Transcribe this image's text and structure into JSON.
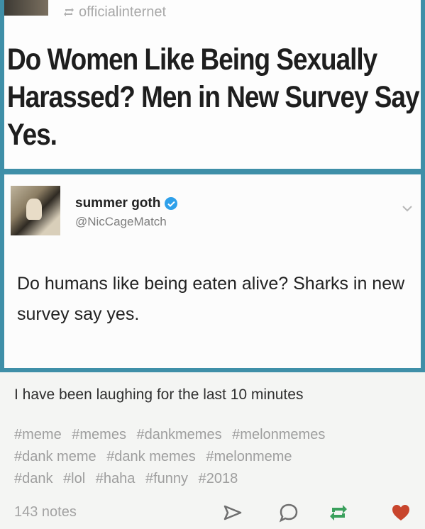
{
  "reblog": {
    "username": "officialinternet",
    "icon": "reblog-icon"
  },
  "headline": {
    "text": "Do Women Like Being Sexually Harassed? Men in New Survey Say Yes."
  },
  "tweet": {
    "display_name": "summer goth",
    "handle": "@NicCageMatch",
    "verified": true,
    "text": "Do humans like being eaten alive? Sharks in new survey say yes."
  },
  "post": {
    "caption": "I have been laughing for the last 10 minutes",
    "tags": [
      "#meme",
      "#memes",
      "#dankmemes",
      "#melonmemes",
      "#dank meme",
      "#dank memes",
      "#melonmeme",
      "#dank",
      "#lol",
      "#haha",
      "#funny",
      "#2018"
    ],
    "notes": "143 notes"
  },
  "actions": [
    "share-icon",
    "reply-icon",
    "reblog-icon",
    "like-icon"
  ],
  "colors": {
    "frame": "#3f8fa8",
    "verified": "#2ea0ea",
    "heart": "#c8452c",
    "reblog_green": "#3aa05c"
  }
}
